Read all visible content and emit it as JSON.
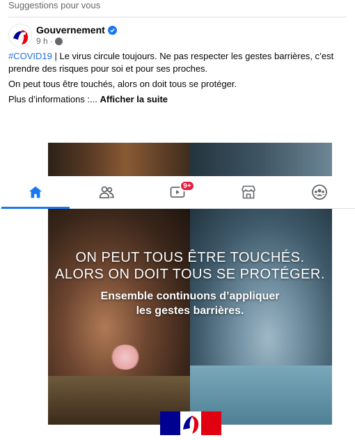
{
  "feed": {
    "section_title": "Suggestions pour vous"
  },
  "post": {
    "author": "Gouvernement",
    "time": "9 h",
    "hashtag": "#COVID19",
    "text_line1": " | Le virus circule toujours. Ne pas respecter les gestes barrières, c’est prendre des risques pour soi et pour ses proches.",
    "text_line2": "On peut tous être touchés, alors on doit tous se protéger.",
    "text_line3_prefix": "Plus d’informations :...",
    "see_more_label": "Afficher la suite",
    "image": {
      "headline_line1": "ON PEUT TOUS ÊTRE TOUCHÉS.",
      "headline_line2": "ALORS ON DOIT TOUS SE PROTÉGER.",
      "sub_line1": "Ensemble continuons d’appliquer",
      "sub_line2": "les gestes barrières."
    }
  },
  "tabs": [
    {
      "name": "home",
      "icon": "home-icon",
      "active": true
    },
    {
      "name": "friends",
      "icon": "friends-icon",
      "active": false
    },
    {
      "name": "watch",
      "icon": "video-icon",
      "active": false,
      "badge": "9+"
    },
    {
      "name": "marketplace",
      "icon": "marketplace-icon",
      "active": false
    },
    {
      "name": "groups",
      "icon": "groups-icon",
      "active": false
    }
  ],
  "colors": {
    "accent": "#1877f2",
    "hashtag": "#216fdb",
    "badge": "#e41e3f",
    "muted_text": "#65676b"
  }
}
